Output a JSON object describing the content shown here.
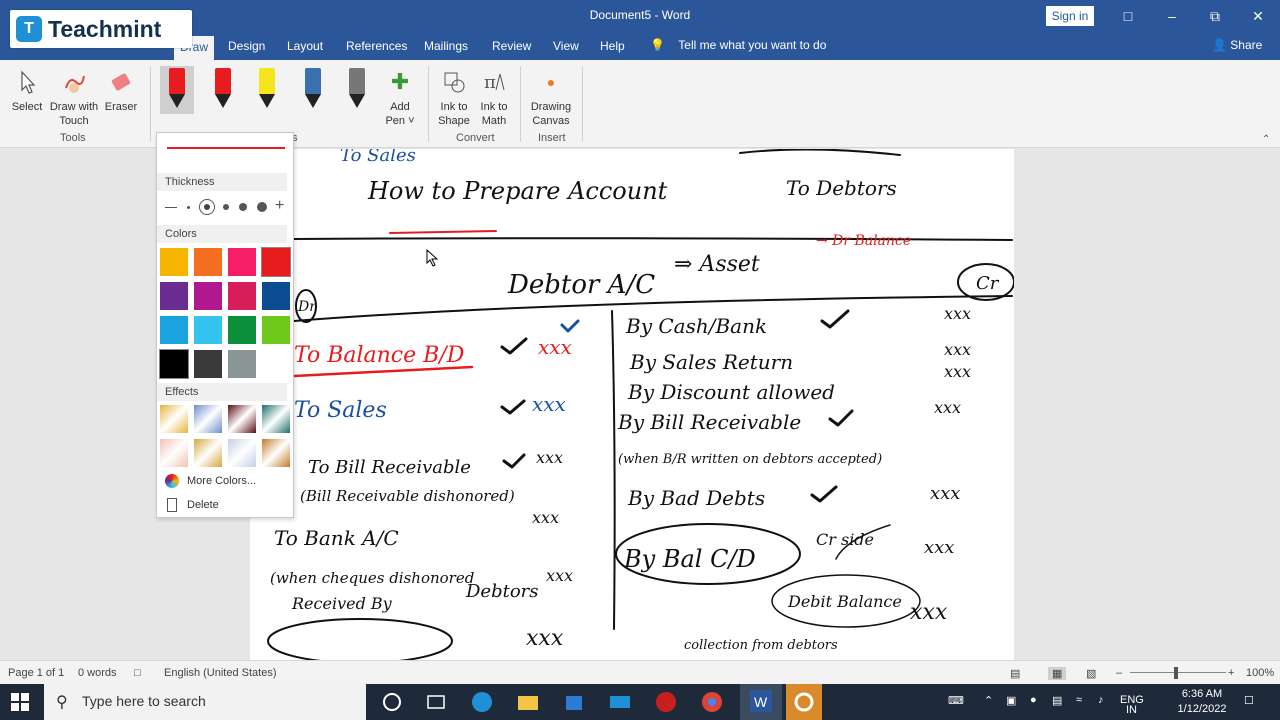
{
  "window": {
    "title": "Document5 - Word",
    "signin": "Sign in"
  },
  "overlay_logo": {
    "text": "Teachmint"
  },
  "tabs": [
    "Draw",
    "Design",
    "Layout",
    "References",
    "Mailings",
    "Review",
    "View",
    "Help"
  ],
  "tellme": "Tell me what you want to do",
  "share": "Share",
  "ribbon": {
    "tools": {
      "select": "Select",
      "draw_touch_1": "Draw with",
      "draw_touch_2": "Touch",
      "eraser": "Eraser",
      "group": "Tools"
    },
    "add_pen_1": "Add",
    "add_pen_2": "Pen ˅",
    "convert": {
      "ink_shape_1": "Ink to",
      "ink_shape_2": "Shape",
      "ink_math_1": "Ink to",
      "ink_math_2": "Math",
      "group": "Convert"
    },
    "insert": {
      "canvas_1": "Drawing",
      "canvas_2": "Canvas",
      "group": "Insert"
    },
    "pens_group_partial": "s"
  },
  "pen_dropdown": {
    "thickness_label": "Thickness",
    "colors_label": "Colors",
    "effects_label": "Effects",
    "more_colors": "More Colors...",
    "delete": "Delete",
    "colors": [
      [
        "#f8b500",
        "#f36f1f",
        "#f61e66",
        "#e81c1c"
      ],
      [
        "#6a2c91",
        "#b0188f",
        "#d81d5b",
        "#0a4c8f"
      ],
      [
        "#1aa3de",
        "#35c3ef",
        "#0b8f3a",
        "#6fc81c"
      ],
      [
        "#000000",
        "#3a3a3a",
        "#8a9595",
        ""
      ]
    ],
    "effects": [
      [
        "#e6b43a",
        "#6b8fc8",
        "#5a0e14",
        "#1b6f6a"
      ],
      [
        "#f2c1b3",
        "#d7a63a",
        "#c4cfe6",
        "#c7792a"
      ]
    ]
  },
  "status": {
    "page": "Page 1 of 1",
    "words": "0 words",
    "language": "English (United States)",
    "zoom": "100%"
  },
  "taskbar": {
    "search_placeholder": "Type here to search",
    "lang_1": "ENG",
    "lang_2": "IN",
    "time": "6:36 AM",
    "date": "1/12/2022"
  },
  "handwriting": {
    "line1": "To Sales",
    "line2": "How to Prepare Account",
    "line3": "To Debtors",
    "heading": "Debtor A/C",
    "asset": "⇒ Asset",
    "dr_bal": "→ Dr Balance",
    "dr": "Dr",
    "cr": "Cr",
    "left": [
      "To Balance B/D",
      "To Sales",
      "To Bill Receivable",
      "(Bill Receivable dishonored)",
      "To Bank A/C",
      "(when cheques dishonored",
      "Received By",
      "Debtors"
    ],
    "left_amounts": [
      "xxx",
      "xxx",
      "xxx",
      "xxx",
      "xxx",
      "xxx"
    ],
    "right": [
      "By Cash/Bank",
      "By Sales Return",
      "By Discount allowed",
      "By Bill Receivable",
      "(when B/R written on debtors accepted)",
      "By Bad Debts",
      "By Bal C/D",
      "Cr side",
      "Debit Balance",
      "collection from debtors"
    ],
    "right_amounts": [
      "xxx",
      "xxx",
      "xxx",
      "xxx",
      "xxx",
      "xxx",
      "xxx"
    ]
  }
}
